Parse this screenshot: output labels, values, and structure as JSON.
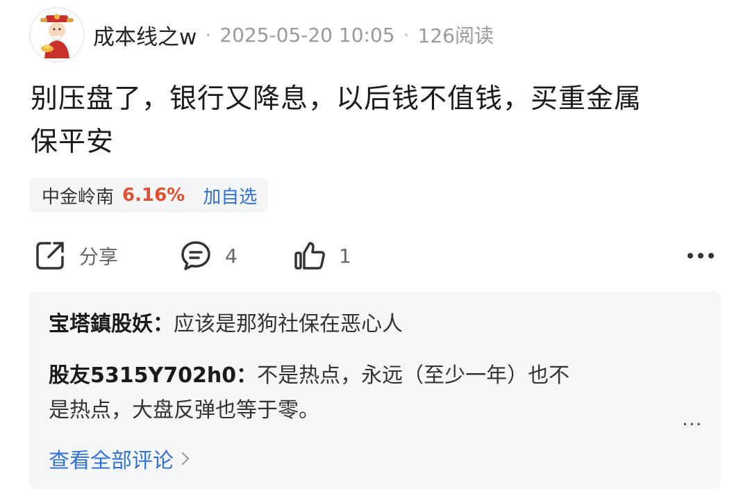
{
  "post": {
    "author": "成本线之w",
    "date": "2025-05-20 10:05",
    "reads": "126阅读",
    "content_line1": "别压盘了，银行又降息，以后钱不值钱，买重金属",
    "content_line2": "保平安"
  },
  "stock": {
    "name": "中金岭南",
    "change": "6.16%",
    "add_label": "加自选"
  },
  "actions": {
    "share_label": "分享",
    "comment_count": "4",
    "like_count": "1"
  },
  "comments": [
    {
      "user": "宝塔鎮股妖",
      "colon": "：",
      "text": "应该是那狗社保在恶心人"
    },
    {
      "user": "股友5315Y702h0",
      "colon": "：",
      "text_line1": "不是热点，永远（至少一年）也不",
      "text_line2": "是热点，大盘反弹也等于零。"
    }
  ],
  "comment_more": "...",
  "view_all_label": "查看全部评论",
  "colors": {
    "accent_blue": "#2f72d8",
    "stock_red": "#e2502f"
  }
}
